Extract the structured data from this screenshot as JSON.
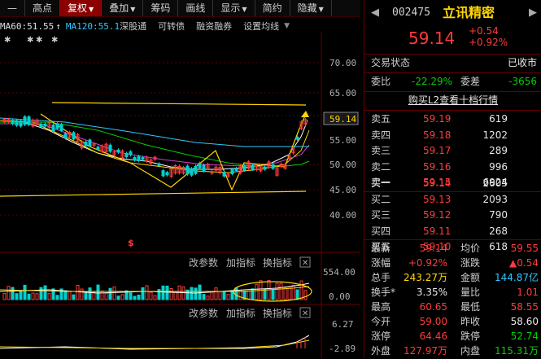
{
  "toolbar": {
    "items": [
      {
        "label": "—"
      },
      {
        "label": "高点"
      },
      {
        "label": "复权"
      },
      {
        "label": "叠加"
      },
      {
        "label": "筹码"
      },
      {
        "label": "画线"
      },
      {
        "label": "显示"
      },
      {
        "label": "简约"
      },
      {
        "label": "隐藏"
      }
    ]
  },
  "ma": {
    "ma60": "MA60:51.55",
    "ma60_arrow": "↑",
    "ma120": "MA120:55.1",
    "tabs": [
      "深股通",
      "可转债",
      "融资融券",
      "设置均线"
    ]
  },
  "price_axis": {
    "ticks": [
      "70.00",
      "65.00",
      "60.00",
      "55.00",
      "50.00",
      "45.00",
      "40.00"
    ],
    "current": "59.14"
  },
  "indicator1": {
    "buttons": [
      "改参数",
      "加指标",
      "换指标"
    ],
    "ticks": [
      "554.00",
      "0.00"
    ]
  },
  "indicator2": {
    "buttons": [
      "改参数",
      "加指标",
      "换指标"
    ],
    "ticks": [
      "6.27",
      "-2.89"
    ]
  },
  "colors": {
    "up": "#ff3b3b",
    "down": "#00d0d0",
    "accent": "#ffd700",
    "border": "#660000"
  },
  "stock": {
    "code": "002475",
    "name": "立讯精密",
    "price": "59.14",
    "change": "+0.54",
    "change_pct": "+0.92%",
    "status_label": "交易状态",
    "status_value": "已收市",
    "weibi_label": "委比",
    "weibi_value": "-22.29%",
    "weicha_label": "委差",
    "weicha_value": "-3656",
    "l2_link": "购买L2查看十档行情"
  },
  "asks": [
    {
      "label": "卖五",
      "price": "59.19",
      "volume": "619"
    },
    {
      "label": "卖四",
      "price": "59.18",
      "volume": "1202"
    },
    {
      "label": "卖三",
      "price": "59.17",
      "volume": "289"
    },
    {
      "label": "卖二",
      "price": "59.16",
      "volume": "996"
    },
    {
      "label": "卖一",
      "price": "59.15",
      "volume": "6924"
    }
  ],
  "bids": [
    {
      "label": "买一",
      "price": "59.14",
      "volume": "2605"
    },
    {
      "label": "买二",
      "price": "59.13",
      "volume": "2093"
    },
    {
      "label": "买三",
      "price": "59.12",
      "volume": "790"
    },
    {
      "label": "买四",
      "price": "59.11",
      "volume": "268"
    },
    {
      "label": "买五",
      "price": "59.10",
      "volume": "618"
    }
  ],
  "stats": [
    {
      "l1": "最新",
      "v1": "59.14",
      "c1": "red",
      "l2": "均价",
      "v2": "59.55",
      "c2": "red"
    },
    {
      "l1": "涨幅",
      "v1": "+0.92%",
      "c1": "red",
      "l2": "涨跌",
      "v2": "▲0.54",
      "c2": "red"
    },
    {
      "l1": "总手",
      "v1": "243.27万",
      "c1": "yellow",
      "l2": "金额",
      "v2": "144.87亿",
      "c2": "cyan"
    },
    {
      "l1": "换手*",
      "v1": "3.35%",
      "c1": "white",
      "l2": "量比",
      "v2": "1.01",
      "c2": "red"
    },
    {
      "l1": "最高",
      "v1": "60.65",
      "c1": "red",
      "l2": "最低",
      "v2": "58.55",
      "c2": "red"
    },
    {
      "l1": "今开",
      "v1": "59.00",
      "c1": "red",
      "l2": "昨收",
      "v2": "58.60",
      "c2": "white"
    },
    {
      "l1": "涨停",
      "v1": "64.46",
      "c1": "red",
      "l2": "跌停",
      "v2": "52.74",
      "c2": "green"
    },
    {
      "l1": "外盘",
      "v1": "127.97万",
      "c1": "red",
      "l2": "内盘",
      "v2": "115.31万",
      "c2": "green"
    }
  ]
}
